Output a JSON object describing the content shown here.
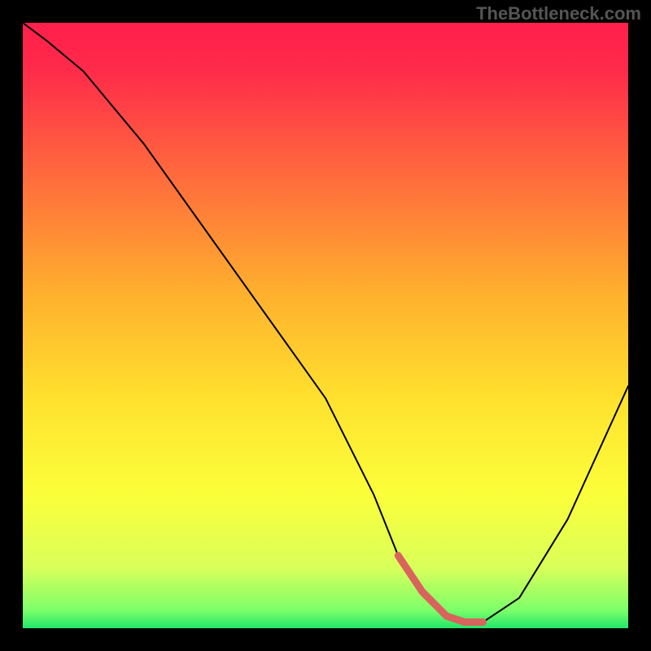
{
  "watermark": "TheBottleneck.com",
  "chart_data": {
    "type": "line",
    "title": "",
    "xlabel": "",
    "ylabel": "",
    "xlim": [
      0,
      100
    ],
    "ylim": [
      0,
      100
    ],
    "series": [
      {
        "name": "bottleneck-curve",
        "x": [
          0,
          4,
          10,
          20,
          30,
          40,
          50,
          58,
          62,
          66,
          70,
          73,
          76,
          82,
          90,
          100
        ],
        "y": [
          100,
          97,
          92,
          80,
          66,
          52,
          38,
          22,
          12,
          6,
          2,
          1,
          1,
          5,
          18,
          40
        ]
      }
    ],
    "highlight_segment": {
      "name": "min-region",
      "x": [
        62,
        66,
        70,
        73,
        76
      ],
      "y": [
        12,
        6,
        2,
        1,
        1
      ]
    },
    "gradient_stops": [
      {
        "offset": 0.0,
        "color": "#ff1f4b"
      },
      {
        "offset": 0.08,
        "color": "#ff2b4a"
      },
      {
        "offset": 0.25,
        "color": "#ff6a3d"
      },
      {
        "offset": 0.45,
        "color": "#ffb12e"
      },
      {
        "offset": 0.62,
        "color": "#ffe12e"
      },
      {
        "offset": 0.78,
        "color": "#fbff3a"
      },
      {
        "offset": 0.9,
        "color": "#d9ff5a"
      },
      {
        "offset": 0.97,
        "color": "#7dff6a"
      },
      {
        "offset": 1.0,
        "color": "#22e76a"
      }
    ]
  }
}
